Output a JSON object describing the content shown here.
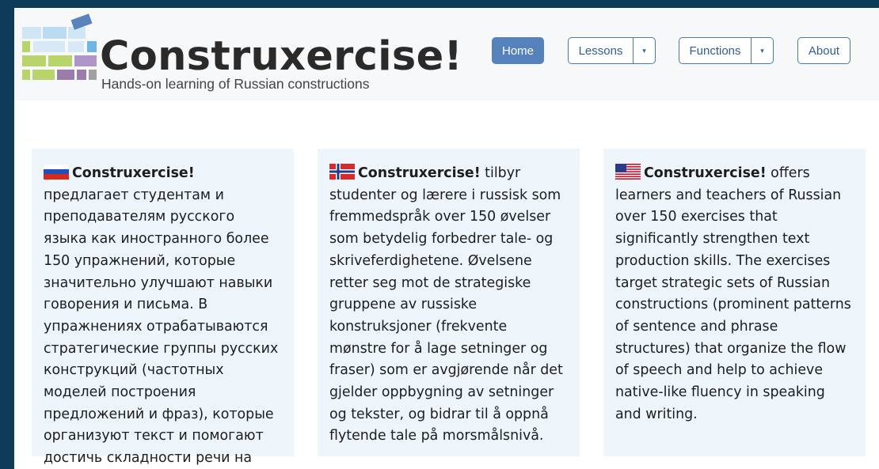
{
  "header": {
    "logo_title": "Construxercise!",
    "logo_tagline": "Hands-on learning of Russian constructions",
    "nav": {
      "home": "Home",
      "lessons": "Lessons",
      "functions": "Functions",
      "about": "About"
    }
  },
  "cards": [
    {
      "flag": "russia-flag-icon",
      "brand": "Construxercise!",
      "text": " предлагает студентам и преподавателям русского языка как иностранного более 150 упражнений, которые значительно улучшают навыки говорения и письма. В упражнениях отрабатываются стратегические группы русских конструкций (частотных моделей построения предложений и фраз), которые организуют текст и помогают достичь складности речи на уровне носителей языка."
    },
    {
      "flag": "norway-flag-icon",
      "brand": "Construxercise!",
      "text": " tilbyr studenter og lærere i russisk som fremmedspråk over 150 øvelser som betydelig forbedrer tale- og skriveferdighetene. Øvelsene retter seg mot de strategiske gruppene av russiske konstruksjoner (frekvente mønstre for å lage setninger og fraser) som er avgjørende når det gjelder oppbygning av setninger og tekster, og bidrar til å oppnå flytende tale på morsmålsnivå."
    },
    {
      "flag": "usa-flag-icon",
      "brand": "Construxercise!",
      "text": " offers learners and teachers of Russian over 150 exercises that significantly strengthen text production skills. The exercises target strategic sets of Russian constructions (prominent patterns of sentence and phrase structures) that organize the flow of speech and help to achieve native-like fluency in speaking and writing."
    }
  ],
  "colors": {
    "background": "#0d3b58",
    "header_bg": "#f7f8fa",
    "card_bg": "#eef6fc",
    "button_border": "#4a79b0",
    "button_active": "#5582bd"
  }
}
